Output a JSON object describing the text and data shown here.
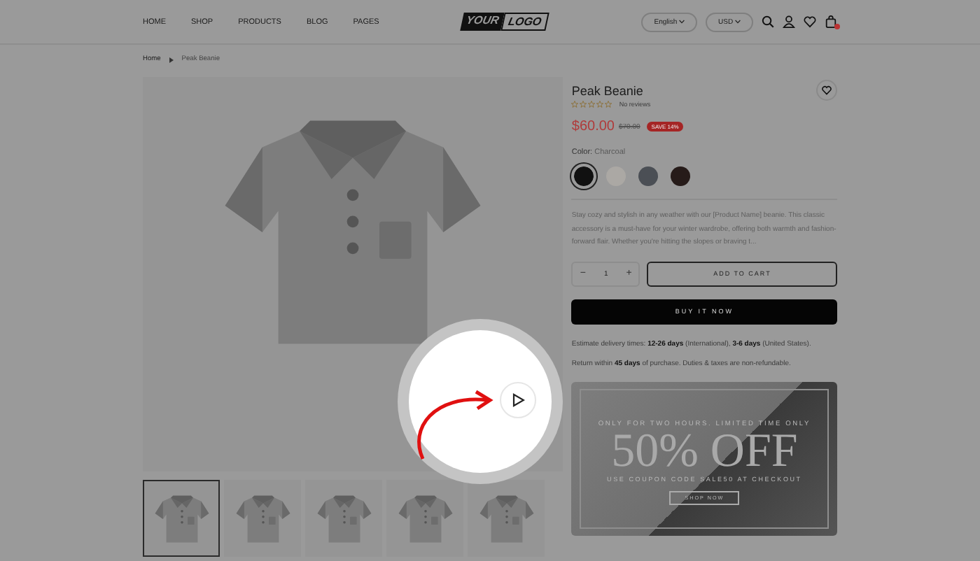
{
  "header": {
    "nav": [
      {
        "label": "HOME"
      },
      {
        "label": "SHOP"
      },
      {
        "label": "PRODUCTS"
      },
      {
        "label": "BLOG"
      },
      {
        "label": "PAGES"
      }
    ],
    "logo": [
      "YOUR",
      "LOGO"
    ],
    "selectors": [
      {
        "label": "English"
      },
      {
        "label": "USD"
      }
    ]
  },
  "breadcrumb": [
    "Home",
    "Peak Beanie"
  ],
  "gallery": {
    "thumbnails": [
      {
        "selected": true
      },
      {
        "selected": false
      },
      {
        "selected": false
      },
      {
        "selected": false
      },
      {
        "selected": false
      }
    ]
  },
  "product": {
    "title": "Peak Beanie",
    "stars": 0,
    "reviews": "No reviews",
    "price": "$60.00",
    "old_price": "$70.00",
    "badge": "SAVE 14%",
    "color_label": "Color:",
    "color_value": "Charcoal",
    "swatches": [
      {
        "color": "#111111",
        "selected": true
      },
      {
        "color": "#aba8a4",
        "selected": false
      },
      {
        "color": "#4b4f55",
        "selected": false
      },
      {
        "color": "#261b19",
        "selected": false
      }
    ],
    "description": "Stay cozy and stylish in any weather with our [Product Name] beanie. This classic accessory is a must-have for your winter wardrobe, offering both warmth and fashion-forward flair. Whether you're hitting the slopes or braving t...",
    "decrement": "−",
    "quantity": "1",
    "increment": "+",
    "add_to_cart": "ADD TO CART",
    "buy_now": "BUY IT NOW",
    "delivery": "Estimate delivery times: **12-26 days** (International), **3-6 days** (United States).",
    "returns": "Return within **45 days** of purchase. Duties & taxes are non-refundable."
  },
  "banner": {
    "kicker": "ONLY FOR TWO HOURS. LIMITED TIME ONLY",
    "headline": "50% OFF",
    "subline": "USE COUPON CODE SALE50 AT CHECKOUT",
    "button": "SHOP NOW"
  }
}
